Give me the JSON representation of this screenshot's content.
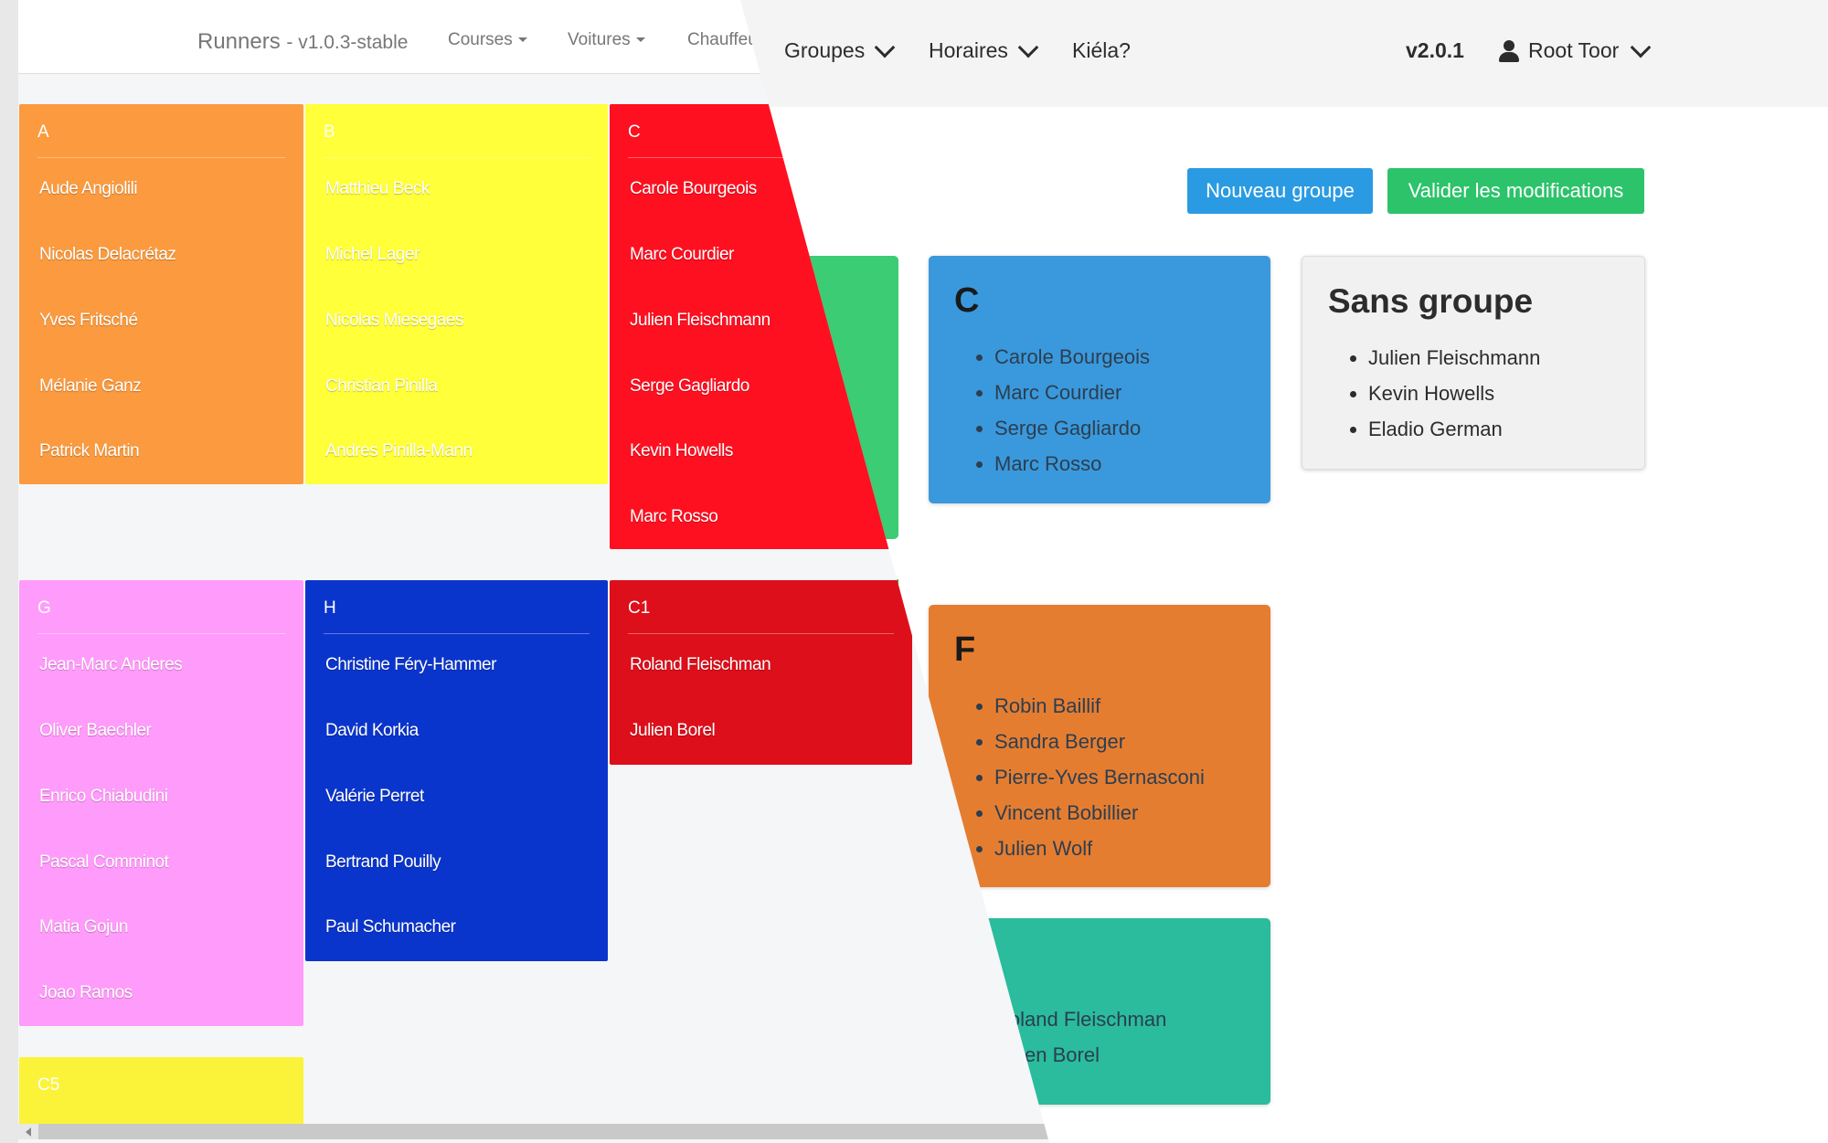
{
  "new_app": {
    "nav": {
      "items": [
        {
          "label": "Groupes"
        },
        {
          "label": "Horaires"
        },
        {
          "label": "Kiéla?"
        }
      ],
      "version": "v2.0.1",
      "user_label": "Root Toor"
    },
    "actions": {
      "new_group_label": "Nouveau groupe",
      "validate_label": "Valider les modifications"
    },
    "groups": [
      {
        "name": "C",
        "color": "#3a99dc",
        "members": [
          "Carole Bourgeois",
          "Marc Courdier",
          "Serge Gagliardo",
          "Marc Rosso"
        ]
      },
      {
        "name": "Sans groupe",
        "color": "#f1f1f1",
        "members": [
          "Julien Fleischmann",
          "Kevin Howells",
          "Eladio German"
        ]
      },
      {
        "name": "F",
        "color": "#e57d31",
        "members": [
          "Robin Baillif",
          "Sandra Berger",
          "Pierre-Yves Bernasconi",
          "Vincent Bobillier",
          "Julien Wolf"
        ]
      },
      {
        "name": "",
        "color": "#2abc9c",
        "members": [
          "Roland Fleischman",
          "Julien Borel"
        ]
      }
    ]
  },
  "old_app": {
    "brand": "Runners",
    "brand_version": "- v1.0.3-stable",
    "nav_items": [
      "Courses",
      "Voitures",
      "Chauffeurs"
    ],
    "groups": [
      {
        "name": "A",
        "color": "#fb9a3e",
        "members": [
          "Aude Angiolili",
          "Nicolas Delacrétaz",
          "Yves Fritsché",
          "Mélanie Ganz",
          "Patrick Martin"
        ]
      },
      {
        "name": "B",
        "color": "#ffff3a",
        "members": [
          "Matthieu Beck",
          "Michel Lager",
          "Nicolas Miesegaes",
          "Christian Pinilla",
          "Andres Pinilla-Mann"
        ]
      },
      {
        "name": "C",
        "color": "#ff1020",
        "members": [
          "Carole Bourgeois",
          "Marc Courdier",
          "Julien Fleischmann",
          "Serge Gagliardo",
          "Kevin Howells",
          "Marc Rosso"
        ]
      },
      {
        "name": "G",
        "color": "#ff9bfa",
        "members": [
          "Jean-Marc Anderes",
          "Oliver Baechler",
          "Enrico Chiabudini",
          "Pascal Comminot",
          "Matia Gojun",
          "Joao Ramos"
        ]
      },
      {
        "name": "H",
        "color": "#0a35cc",
        "members": [
          "Christine Féry-Hammer",
          "David Korkia",
          "Valérie Perret",
          "Bertrand Pouilly",
          "Paul Schumacher"
        ]
      },
      {
        "name": "C1",
        "color": "#dd0f1a",
        "members": [
          "Roland Fleischman",
          "Julien Borel"
        ]
      },
      {
        "name": "C5",
        "color": "#fbf33a",
        "members": []
      }
    ]
  }
}
